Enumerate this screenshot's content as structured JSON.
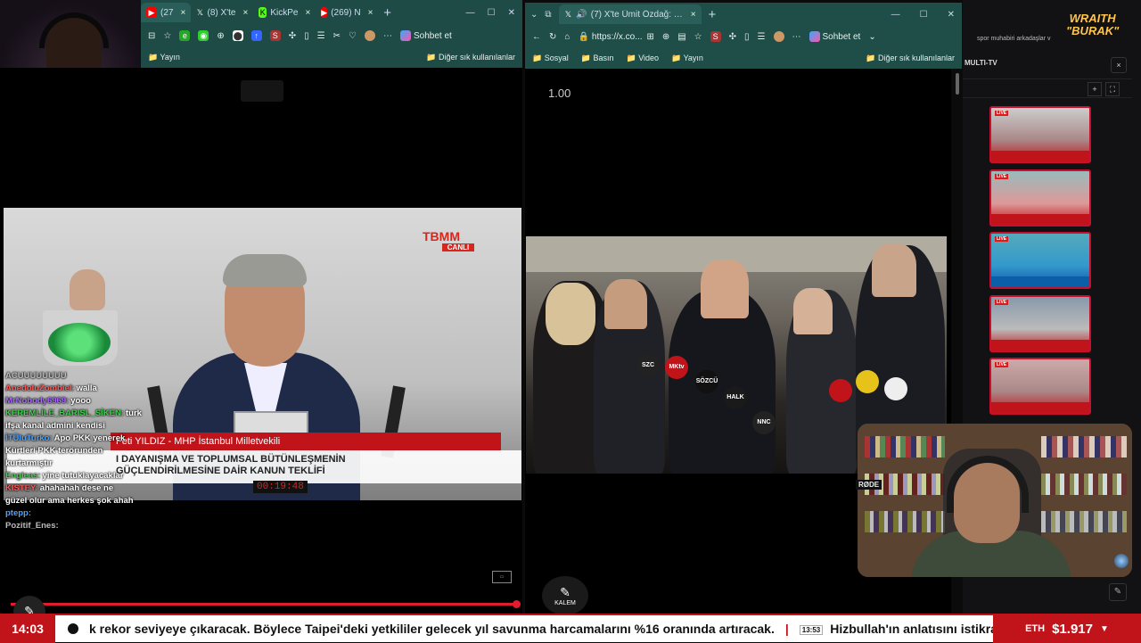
{
  "left_browser": {
    "tabs": [
      {
        "label": "(27",
        "icon": "youtube-icon",
        "color": "#ff0000"
      },
      {
        "label": "(8) X'te",
        "icon": "x-icon",
        "color": "#ffffff"
      },
      {
        "label": "KickPe",
        "icon": "kick-icon",
        "color": "#53fc18"
      },
      {
        "label": "(269) N",
        "icon": "youtube-icon",
        "color": "#ff0000"
      }
    ],
    "new_tab": "+",
    "copilot_label": "Sohbet et",
    "favorites": [
      "Yayın"
    ],
    "other_favorites": "Diğer sık kullanılanlar"
  },
  "left_chat": [
    {
      "user": "ACUUUUUUUU",
      "msg": "",
      "color": "#bbbbbb"
    },
    {
      "user": "AnedoluZombiel:",
      "msg": "walla",
      "color": "#ff5a5a"
    },
    {
      "user": "MrNobody6969:",
      "msg": "yooo",
      "color": "#a86bff"
    },
    {
      "user": "KEREMLİLE_BARISL_SİKEN:",
      "msg": "turk",
      "color": "#3fd14e"
    },
    {
      "user": "",
      "msg": "ifşa kanal admini kendisi",
      "color": "#ffffff"
    },
    {
      "user": "İTÜluTurko:",
      "msg": "Apo PKK yenerek",
      "color": "#4da3ff"
    },
    {
      "user": "",
      "msg": "Kürtleri PKK terörunden",
      "color": "#ffffff"
    },
    {
      "user": "",
      "msg": "kurtarmıştır",
      "color": "#ffffff"
    },
    {
      "user": "Engleas:",
      "msg": "yine tutuklayacaklar",
      "color": "#3fd14e"
    },
    {
      "user": "KISTEY:",
      "msg": "ahahahah dese ne",
      "color": "#ff5a5a"
    },
    {
      "user": "",
      "msg": "güzel olur ama herkes şok ahah",
      "color": "#ffffff"
    },
    {
      "user": "ptepp:",
      "msg": "",
      "color": "#4da3ff"
    },
    {
      "user": "Pozitif_Enes:",
      "msg": "",
      "color": "#bbbbbb"
    }
  ],
  "tbmm": {
    "logo": "TBMM",
    "live": "CANLI",
    "speaker_bar": "Feti YILDIZ - MHP İstanbul Milletvekili",
    "law_line1": "I DAYANIŞMA VE TOPLUMSAL BÜTÜNLEŞMENİN",
    "law_line2": "GÜÇLENDİRİLMESİNE DAİR KANUN TEKLİFİ",
    "timer": "00:19:48"
  },
  "right_browser": {
    "tab_label": "(7) X'te Ümit Özdağ: \"Kuvay-",
    "new_tab": "+",
    "url": "https://x.co...",
    "copilot_label": "Sohbet et",
    "favorites": [
      "Sosyal",
      "Basın",
      "Video",
      "Yayın"
    ],
    "other_favorites": "Diğer sık kullanılanlar"
  },
  "video_speed": "1.00",
  "pen_label": "KALEM",
  "mic_labels": [
    "SZC",
    "MKtv",
    "SÖZCÜ",
    "HALK",
    "NNC"
  ],
  "side_panel": {
    "title": "MULTI-TV",
    "close": "×",
    "header_marquee": "spor muhabiri arkadaşlar v",
    "brand": [
      "WRAITH",
      "\"BURAK\""
    ],
    "thumbnails": [
      {
        "live": "LIVE"
      },
      {
        "live": "LIVE"
      },
      {
        "live": "LIVE"
      },
      {
        "live": "LIVE"
      },
      {
        "live": "LIVE"
      }
    ]
  },
  "rode_label": "RØDE",
  "ticker": {
    "time": "14:03",
    "text1": "k rekor seviyeye çıkaracak. Böylece Taipei'deki yetkililer gelecek yıl savunma harcamalarını %16 oranında artıracak.",
    "separator": "|",
    "stamp": "13:53",
    "text2": "Hizbullah'ın anlatısını istikrar",
    "eth_label": "ETH",
    "eth_value": "$1.917",
    "eth_arrow": "▼"
  }
}
